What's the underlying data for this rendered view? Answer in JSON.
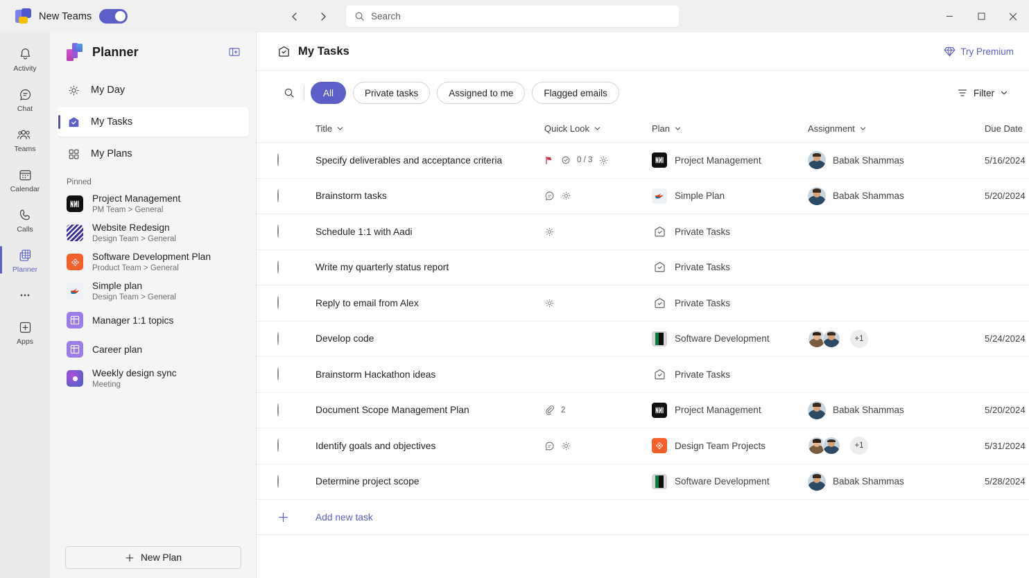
{
  "titlebar": {
    "new_teams_label": "New Teams",
    "toggle_on": true,
    "search_placeholder": "Search",
    "back_icon": "chevron-left-icon",
    "forward_icon": "chevron-right-icon",
    "minimize": "minimize-icon",
    "maximize": "maximize-icon",
    "close": "close-icon"
  },
  "rail": {
    "items": [
      {
        "label": "Activity",
        "icon": "bell-icon",
        "active": false
      },
      {
        "label": "Chat",
        "icon": "chat-icon",
        "active": false
      },
      {
        "label": "Teams",
        "icon": "teams-icon",
        "active": false
      },
      {
        "label": "Calendar",
        "icon": "calendar-icon",
        "active": false
      },
      {
        "label": "Calls",
        "icon": "phone-icon",
        "active": false
      },
      {
        "label": "Planner",
        "icon": "planner-icon",
        "active": true
      },
      {
        "label": "",
        "icon": "more-ellipsis-icon",
        "active": false
      },
      {
        "label": "Apps",
        "icon": "apps-plus-icon",
        "active": false
      }
    ]
  },
  "sidebar": {
    "title": "Planner",
    "collapse_icon": "collapse-panel-icon",
    "nav": [
      {
        "label": "My Day",
        "icon": "sun-icon",
        "active": false
      },
      {
        "label": "My Tasks",
        "icon": "tasks-home-icon",
        "active": true
      },
      {
        "label": "My Plans",
        "icon": "grid-icon",
        "active": false
      }
    ],
    "pinned_label": "Pinned",
    "pinned": [
      {
        "name": "Project Management",
        "sub": "PM Team > General",
        "icon": "plan-black-icon"
      },
      {
        "name": "Website Redesign",
        "sub": "Design Team > General",
        "icon": "plan-stripes-icon"
      },
      {
        "name": "Software Development Plan",
        "sub": "Product Team > General",
        "icon": "plan-orange-icon"
      },
      {
        "name": "Simple plan",
        "sub": "Design Team > General",
        "icon": "plan-bird-icon"
      },
      {
        "name": "Manager 1:1 topics",
        "sub": "",
        "icon": "plan-purple-grid-icon"
      },
      {
        "name": "Career plan",
        "sub": "",
        "icon": "plan-purple-grid-icon"
      },
      {
        "name": "Weekly design sync",
        "sub": "Meeting",
        "icon": "plan-meeting-icon"
      }
    ],
    "new_plan_label": "New Plan"
  },
  "main": {
    "page_title": "My Tasks",
    "page_icon": "tasks-home-icon",
    "premium_label": "Try Premium",
    "premium_icon": "diamond-icon",
    "search_icon": "search-icon",
    "pills": [
      {
        "label": "All",
        "selected": true
      },
      {
        "label": "Private tasks",
        "selected": false
      },
      {
        "label": "Assigned to me",
        "selected": false
      },
      {
        "label": "Flagged emails",
        "selected": false
      }
    ],
    "filter_label": "Filter",
    "filter_icon": "filter-icon",
    "columns": {
      "title": "Title",
      "quick_look": "Quick Look",
      "plan": "Plan",
      "assignment": "Assignment",
      "due_date": "Due Date"
    },
    "add_task_label": "Add new task",
    "rows": [
      {
        "title": "Specify deliverables and acceptance criteria",
        "quick": {
          "flag": true,
          "checklist": "0 / 3",
          "myday": true,
          "note": false,
          "attach": ""
        },
        "plan": "Project Management",
        "plan_icon": "plan-black-icon",
        "assignees": [
          "Babak Shammas"
        ],
        "extra": "",
        "assignee_label": "Babak Shammas",
        "due": "5/16/2024"
      },
      {
        "title": "Brainstorm tasks",
        "quick": {
          "flag": false,
          "checklist": "",
          "myday": true,
          "note": true,
          "attach": ""
        },
        "plan": "Simple Plan",
        "plan_icon": "plan-bird-icon",
        "assignees": [
          "Babak Shammas"
        ],
        "extra": "",
        "assignee_label": "Babak Shammas",
        "due": "5/20/2024"
      },
      {
        "title": "Schedule 1:1 with Aadi",
        "quick": {
          "flag": false,
          "checklist": "",
          "myday": true,
          "note": false,
          "attach": ""
        },
        "plan": "Private Tasks",
        "plan_icon": "private-tasks-icon",
        "assignees": [],
        "extra": "",
        "assignee_label": "",
        "due": ""
      },
      {
        "title": "Write my quarterly status report",
        "quick": {
          "flag": false,
          "checklist": "",
          "myday": false,
          "note": false,
          "attach": ""
        },
        "plan": "Private Tasks",
        "plan_icon": "private-tasks-icon",
        "assignees": [],
        "extra": "",
        "assignee_label": "",
        "due": ""
      },
      {
        "title": "Reply to email from Alex",
        "quick": {
          "flag": false,
          "checklist": "",
          "myday": true,
          "note": false,
          "attach": ""
        },
        "plan": "Private Tasks",
        "plan_icon": "private-tasks-icon",
        "assignees": [],
        "extra": "",
        "assignee_label": "",
        "due": ""
      },
      {
        "title": "Develop code",
        "quick": {
          "flag": false,
          "checklist": "",
          "myday": false,
          "note": false,
          "attach": ""
        },
        "plan": "Software Development",
        "plan_icon": "plan-green-icon",
        "assignees": [
          "a",
          "b"
        ],
        "extra": "+1",
        "assignee_label": "",
        "due": "5/24/2024"
      },
      {
        "title": "Brainstorm Hackathon ideas",
        "quick": {
          "flag": false,
          "checklist": "",
          "myday": false,
          "note": false,
          "attach": ""
        },
        "plan": "Private Tasks",
        "plan_icon": "private-tasks-icon",
        "assignees": [],
        "extra": "",
        "assignee_label": "",
        "due": ""
      },
      {
        "title": "Document Scope Management Plan",
        "quick": {
          "flag": false,
          "checklist": "",
          "myday": false,
          "note": false,
          "attach": "2"
        },
        "plan": "Project Management",
        "plan_icon": "plan-black-icon",
        "assignees": [
          "Babak Shammas"
        ],
        "extra": "",
        "assignee_label": "Babak Shammas",
        "due": "5/20/2024"
      },
      {
        "title": "Identify goals and objectives",
        "quick": {
          "flag": false,
          "checklist": "",
          "myday": true,
          "note": true,
          "attach": ""
        },
        "plan": "Design Team Projects",
        "plan_icon": "plan-orange-icon",
        "assignees": [
          "a",
          "b"
        ],
        "extra": "+1",
        "assignee_label": "",
        "due": "5/31/2024"
      },
      {
        "title": "Determine project scope",
        "quick": {
          "flag": false,
          "checklist": "",
          "myday": false,
          "note": false,
          "attach": ""
        },
        "plan": "Software Development",
        "plan_icon": "plan-green-icon",
        "assignees": [
          "Babak Shammas"
        ],
        "extra": "",
        "assignee_label": "Babak Shammas",
        "due": "5/28/2024"
      }
    ]
  },
  "colors": {
    "accent": "#5b5fc7",
    "accent_dark": "#4f52b2",
    "flag_red": "#c4314b",
    "orange": "#f4602c",
    "text": "#242424",
    "muted": "#616161"
  }
}
